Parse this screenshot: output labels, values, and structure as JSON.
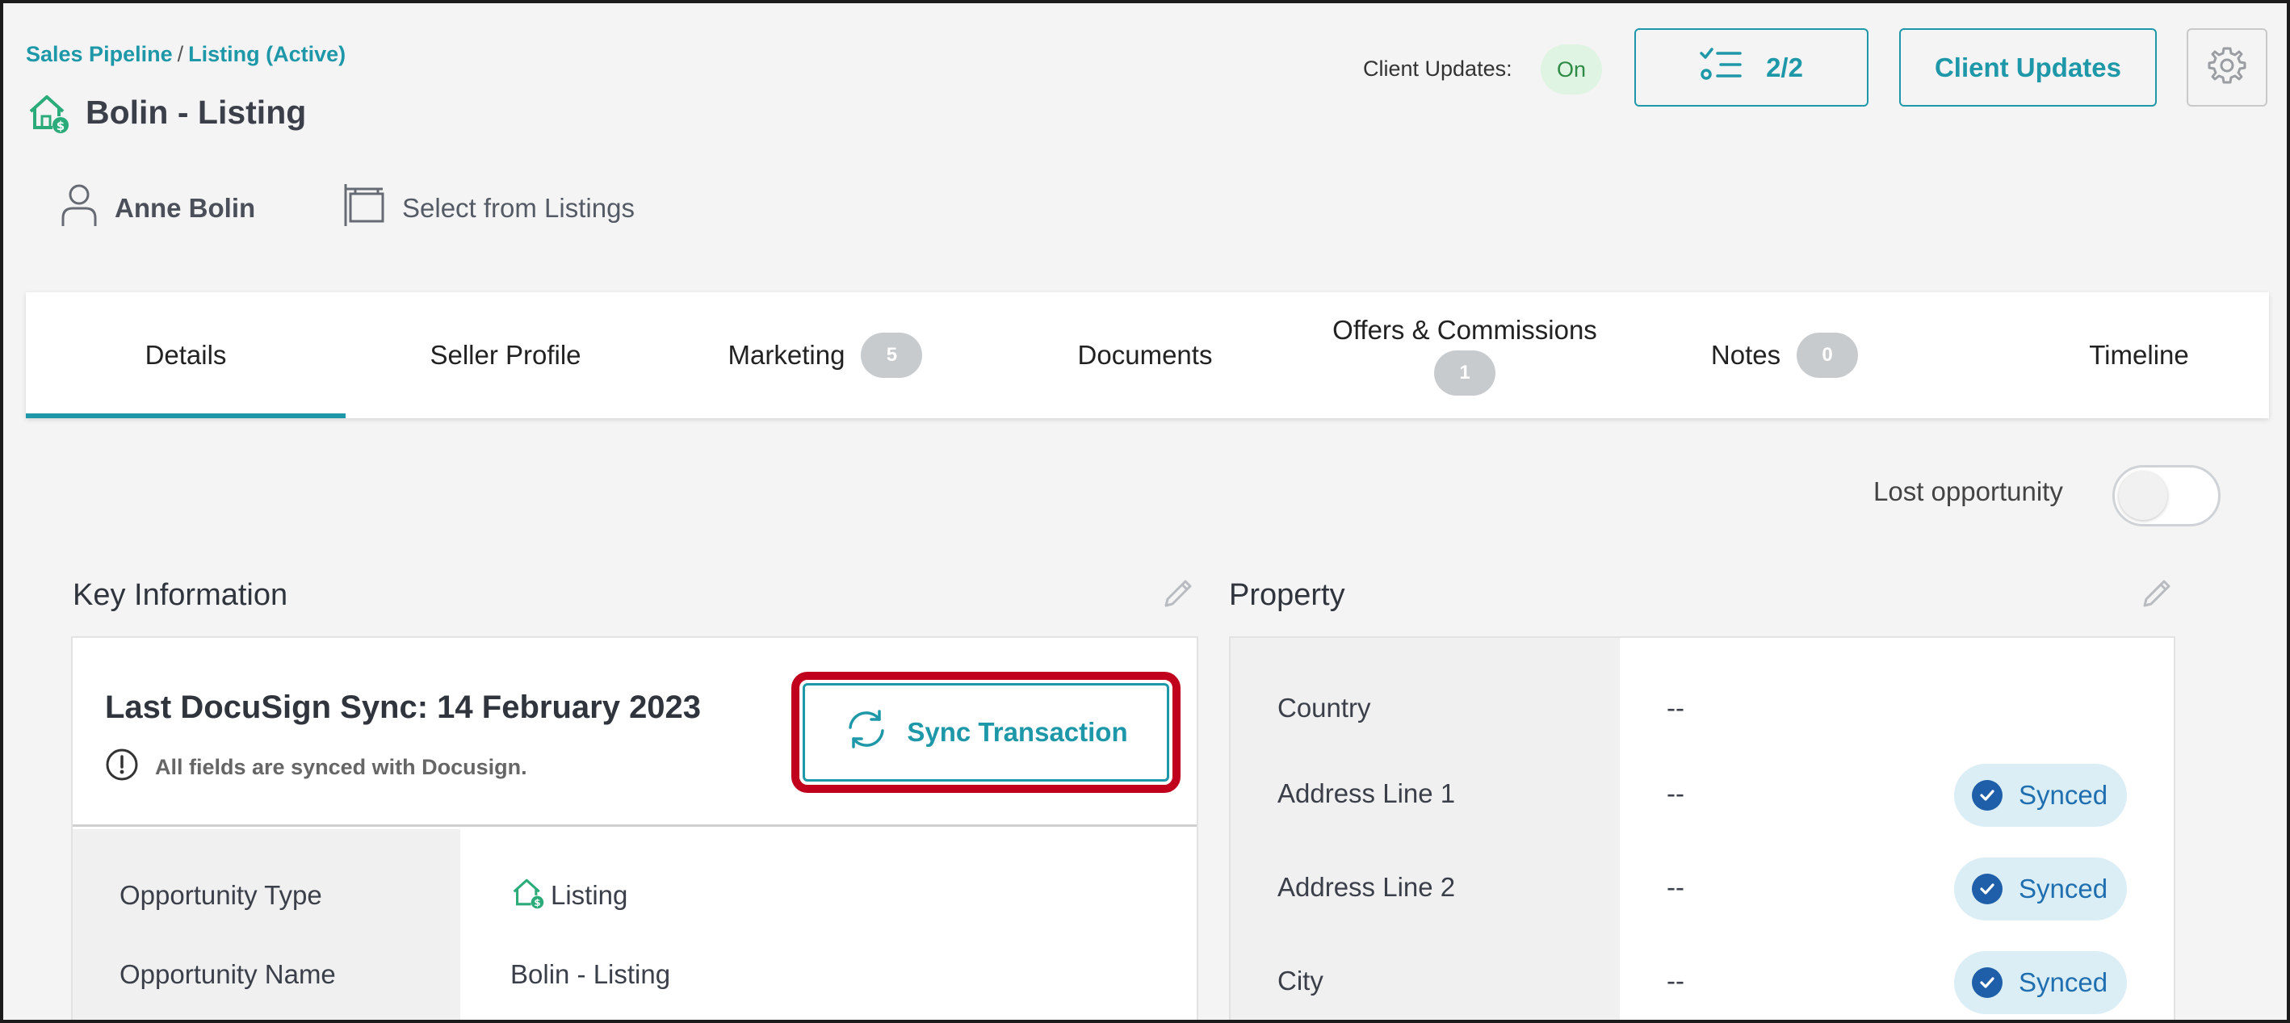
{
  "breadcrumb": {
    "root": "Sales Pipeline",
    "separator": "/",
    "current": "Listing (Active)"
  },
  "page": {
    "title": "Bolin - Listing",
    "title_icon": "house-dollar-icon"
  },
  "header": {
    "client_updates_label": "Client Updates:",
    "client_updates_status": "On",
    "tasks_count": "2/2",
    "client_updates_button": "Client Updates"
  },
  "contact": {
    "name": "Anne Bolin",
    "listing_select": "Select from Listings"
  },
  "tabs": [
    {
      "label": "Details",
      "badge": null,
      "active": true
    },
    {
      "label": "Seller Profile",
      "badge": null
    },
    {
      "label": "Marketing",
      "badge": "5"
    },
    {
      "label": "Documents",
      "badge": null
    },
    {
      "label": "Offers & Commissions",
      "badge": "1"
    },
    {
      "label": "Notes",
      "badge": "0"
    },
    {
      "label": "Timeline",
      "badge": null
    }
  ],
  "lost_opportunity": {
    "label": "Lost opportunity",
    "enabled": false
  },
  "key_information": {
    "title": "Key Information",
    "sync_title": "Last DocuSign Sync: 14 February 2023",
    "sync_note": "All fields are synced with Docusign.",
    "sync_button": "Sync Transaction",
    "rows": [
      {
        "label": "Opportunity Type",
        "value": "Listing"
      },
      {
        "label": "Opportunity Name",
        "value": "Bolin - Listing"
      }
    ]
  },
  "property": {
    "title": "Property",
    "rows": [
      {
        "label": "Country",
        "value": "--",
        "status": null
      },
      {
        "label": "Address Line 1",
        "value": "--",
        "status": "Synced"
      },
      {
        "label": "Address Line 2",
        "value": "--",
        "status": "Synced"
      },
      {
        "label": "City",
        "value": "--",
        "status": "Synced"
      }
    ]
  },
  "colors": {
    "accent": "#1e98a8",
    "highlight": "#c0001c",
    "synced_bg": "#dbeef5",
    "on_pill": "#dff4e3"
  }
}
